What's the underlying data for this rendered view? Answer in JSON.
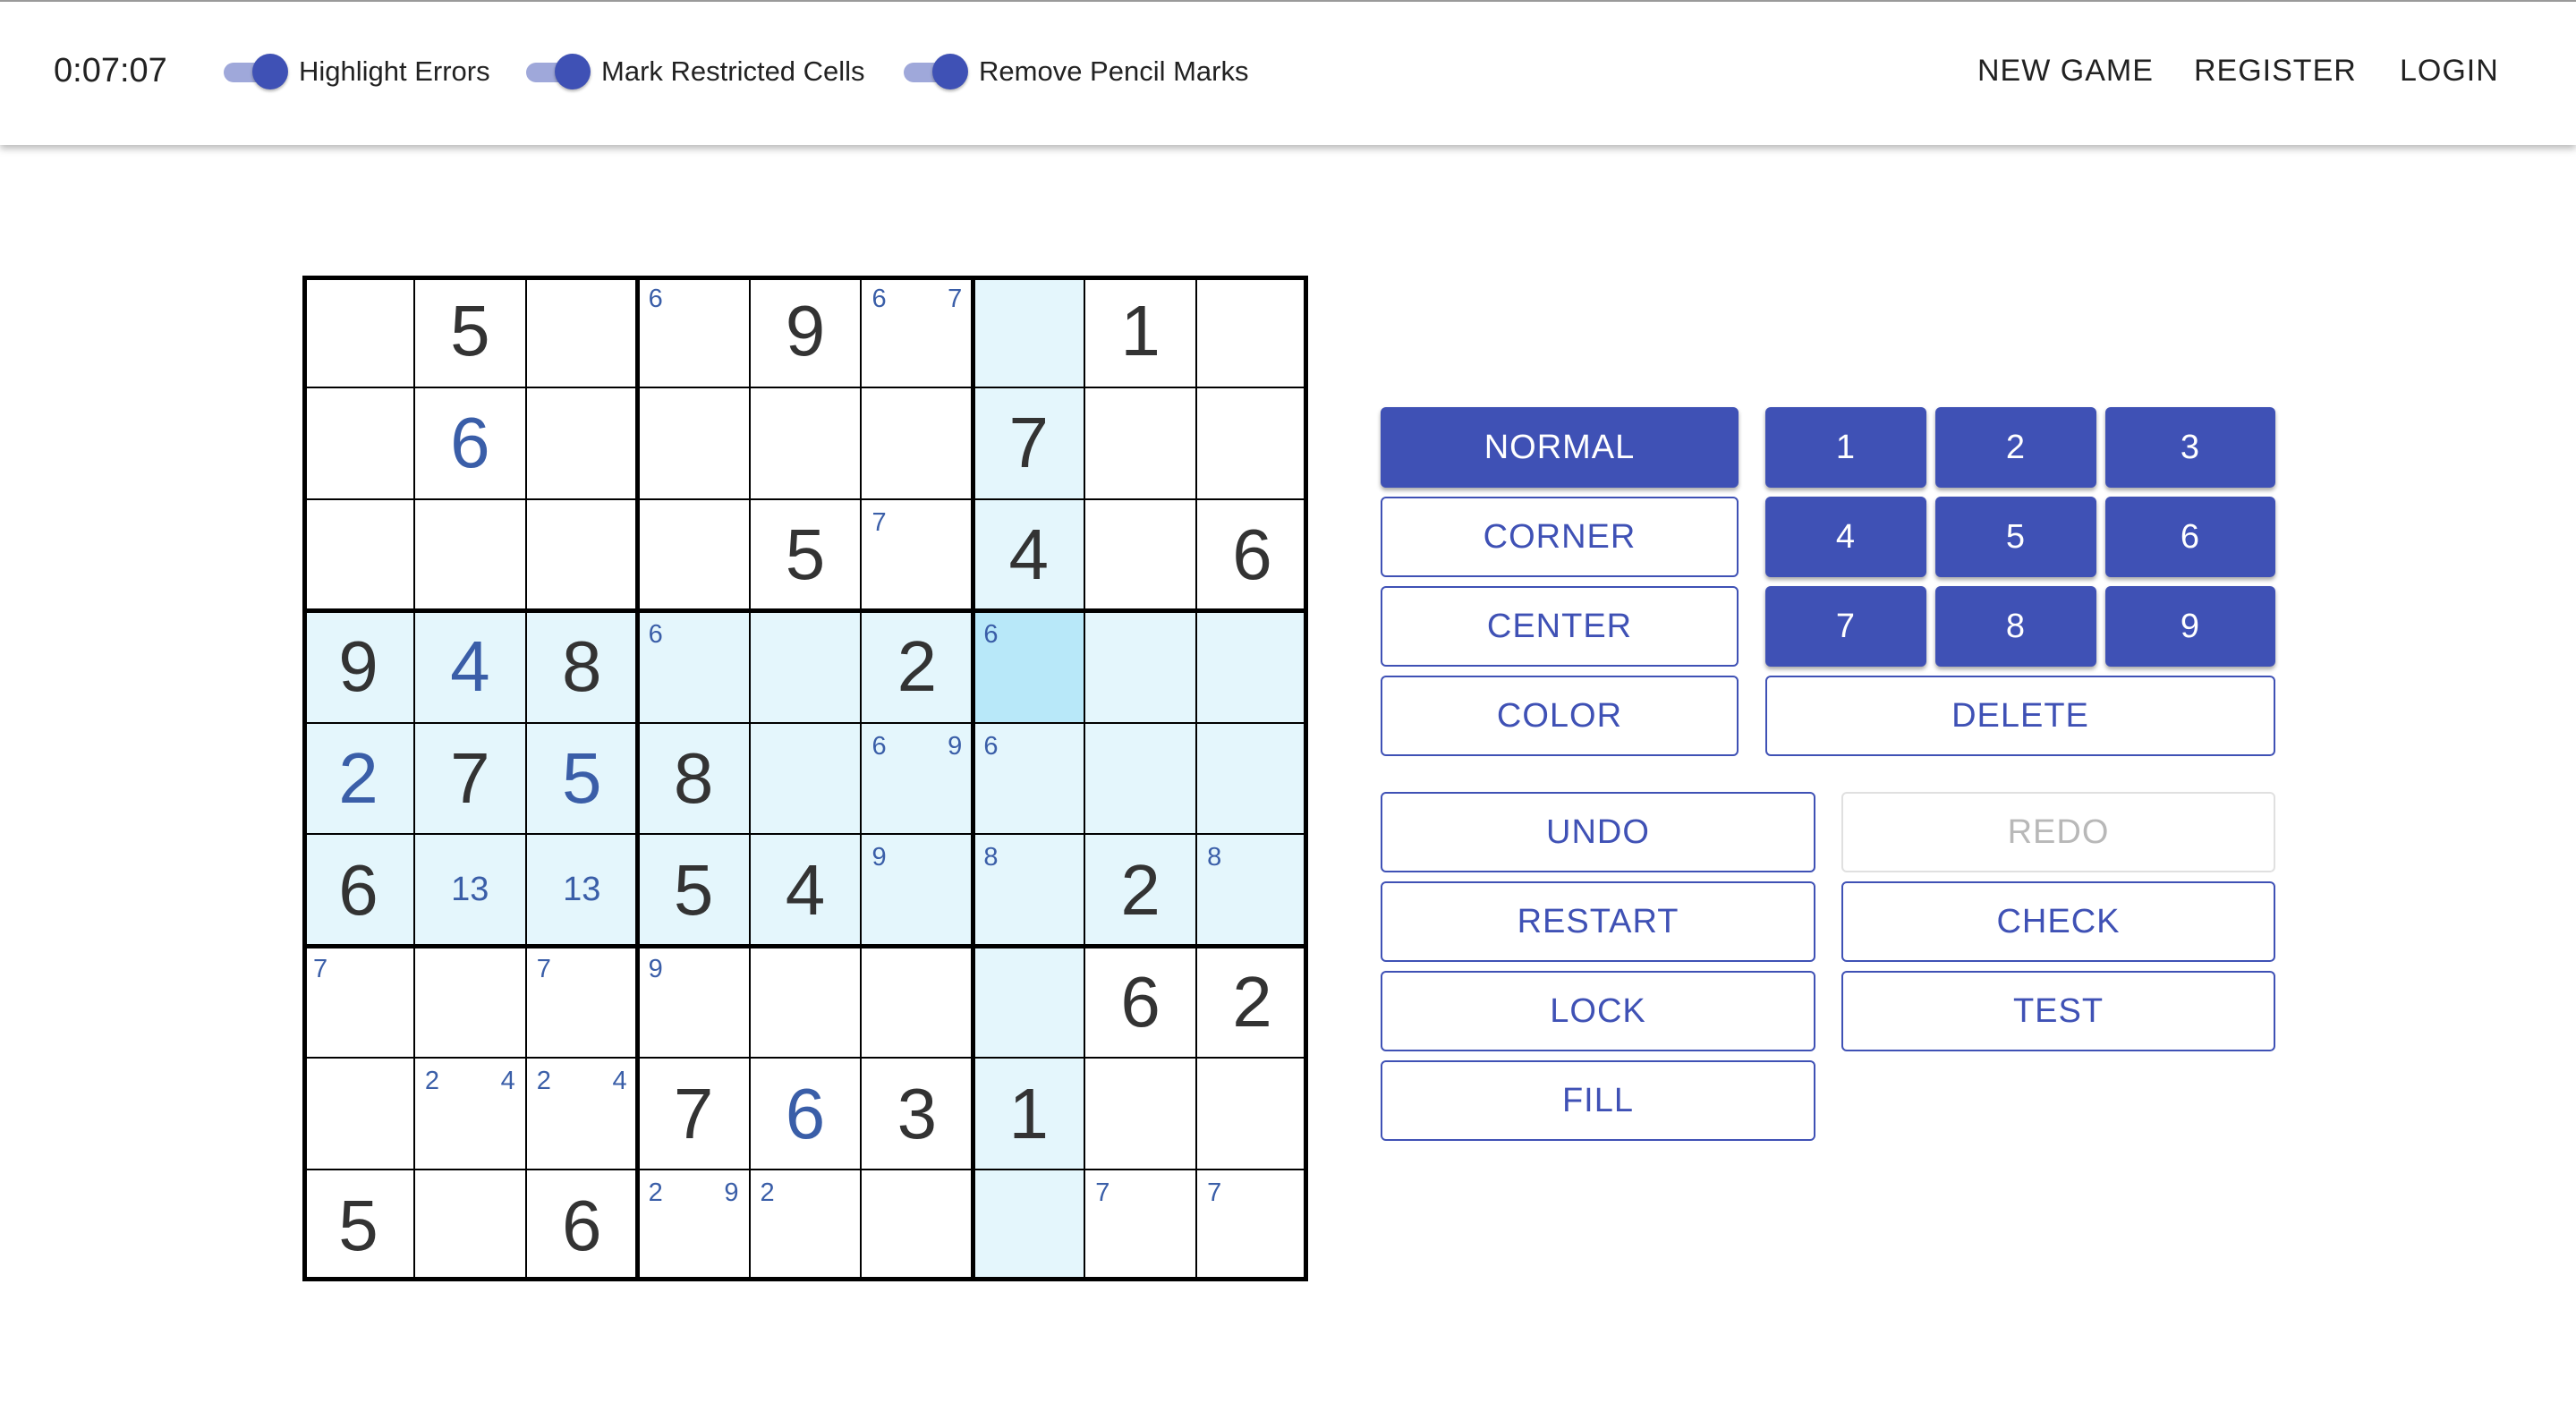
{
  "header": {
    "timer": "0:07:07",
    "toggles": [
      {
        "label": "Highlight Errors",
        "on": true
      },
      {
        "label": "Mark Restricted Cells",
        "on": true
      },
      {
        "label": "Remove Pencil Marks",
        "on": true
      }
    ],
    "nav": {
      "new_game": "NEW GAME",
      "register": "REGISTER",
      "login": "LOGIN"
    }
  },
  "colors": {
    "accent": "#3f51b5",
    "toggle_track": "#9fa8da",
    "given_digit": "#333333",
    "entered_digit": "#3a5ea8",
    "pencil_mark": "#3a5ea8",
    "highlight": "#e4f6fc",
    "selected": "#b8e8f9"
  },
  "board": {
    "selected": [
      3,
      6
    ],
    "highlighted_rows": [
      3,
      4,
      5
    ],
    "highlighted_cols": [
      6
    ],
    "cells": [
      [
        {
          "v": "",
          "t": "empty",
          "corner": [],
          "center": ""
        },
        {
          "v": "5",
          "t": "given",
          "corner": [],
          "center": ""
        },
        {
          "v": "",
          "t": "empty",
          "corner": [],
          "center": ""
        },
        {
          "v": "",
          "t": "empty",
          "corner": [
            "6"
          ],
          "center": ""
        },
        {
          "v": "9",
          "t": "given",
          "corner": [],
          "center": ""
        },
        {
          "v": "",
          "t": "empty",
          "corner": [
            "6",
            "7"
          ],
          "center": ""
        },
        {
          "v": "",
          "t": "empty",
          "corner": [],
          "center": ""
        },
        {
          "v": "1",
          "t": "given",
          "corner": [],
          "center": ""
        },
        {
          "v": "",
          "t": "empty",
          "corner": [],
          "center": ""
        }
      ],
      [
        {
          "v": "",
          "t": "empty",
          "corner": [],
          "center": ""
        },
        {
          "v": "6",
          "t": "entered",
          "corner": [],
          "center": ""
        },
        {
          "v": "",
          "t": "empty",
          "corner": [],
          "center": ""
        },
        {
          "v": "",
          "t": "empty",
          "corner": [],
          "center": ""
        },
        {
          "v": "",
          "t": "empty",
          "corner": [],
          "center": ""
        },
        {
          "v": "",
          "t": "empty",
          "corner": [],
          "center": ""
        },
        {
          "v": "7",
          "t": "given",
          "corner": [],
          "center": ""
        },
        {
          "v": "",
          "t": "empty",
          "corner": [],
          "center": ""
        },
        {
          "v": "",
          "t": "empty",
          "corner": [],
          "center": ""
        }
      ],
      [
        {
          "v": "",
          "t": "empty",
          "corner": [],
          "center": ""
        },
        {
          "v": "",
          "t": "empty",
          "corner": [],
          "center": ""
        },
        {
          "v": "",
          "t": "empty",
          "corner": [],
          "center": ""
        },
        {
          "v": "",
          "t": "empty",
          "corner": [],
          "center": ""
        },
        {
          "v": "5",
          "t": "given",
          "corner": [],
          "center": ""
        },
        {
          "v": "",
          "t": "empty",
          "corner": [
            "7"
          ],
          "center": ""
        },
        {
          "v": "4",
          "t": "given",
          "corner": [],
          "center": ""
        },
        {
          "v": "",
          "t": "empty",
          "corner": [],
          "center": ""
        },
        {
          "v": "6",
          "t": "given",
          "corner": [],
          "center": ""
        }
      ],
      [
        {
          "v": "9",
          "t": "given",
          "corner": [],
          "center": ""
        },
        {
          "v": "4",
          "t": "entered",
          "corner": [],
          "center": ""
        },
        {
          "v": "8",
          "t": "given",
          "corner": [],
          "center": ""
        },
        {
          "v": "",
          "t": "empty",
          "corner": [
            "6"
          ],
          "center": ""
        },
        {
          "v": "",
          "t": "empty",
          "corner": [],
          "center": ""
        },
        {
          "v": "2",
          "t": "given",
          "corner": [],
          "center": ""
        },
        {
          "v": "",
          "t": "empty",
          "corner": [
            "6"
          ],
          "center": ""
        },
        {
          "v": "",
          "t": "empty",
          "corner": [],
          "center": ""
        },
        {
          "v": "",
          "t": "empty",
          "corner": [],
          "center": ""
        }
      ],
      [
        {
          "v": "2",
          "t": "entered",
          "corner": [],
          "center": ""
        },
        {
          "v": "7",
          "t": "given",
          "corner": [],
          "center": ""
        },
        {
          "v": "5",
          "t": "entered",
          "corner": [],
          "center": ""
        },
        {
          "v": "8",
          "t": "given",
          "corner": [],
          "center": ""
        },
        {
          "v": "",
          "t": "empty",
          "corner": [],
          "center": ""
        },
        {
          "v": "",
          "t": "empty",
          "corner": [
            "6",
            "9"
          ],
          "center": ""
        },
        {
          "v": "",
          "t": "empty",
          "corner": [
            "6"
          ],
          "center": ""
        },
        {
          "v": "",
          "t": "empty",
          "corner": [],
          "center": ""
        },
        {
          "v": "",
          "t": "empty",
          "corner": [],
          "center": ""
        }
      ],
      [
        {
          "v": "6",
          "t": "given",
          "corner": [],
          "center": ""
        },
        {
          "v": "",
          "t": "empty",
          "corner": [],
          "center": "13"
        },
        {
          "v": "",
          "t": "empty",
          "corner": [],
          "center": "13"
        },
        {
          "v": "5",
          "t": "given",
          "corner": [],
          "center": ""
        },
        {
          "v": "4",
          "t": "given",
          "corner": [],
          "center": ""
        },
        {
          "v": "",
          "t": "empty",
          "corner": [
            "9"
          ],
          "center": ""
        },
        {
          "v": "",
          "t": "empty",
          "corner": [
            "8"
          ],
          "center": ""
        },
        {
          "v": "2",
          "t": "given",
          "corner": [],
          "center": ""
        },
        {
          "v": "",
          "t": "empty",
          "corner": [
            "8"
          ],
          "center": ""
        }
      ],
      [
        {
          "v": "",
          "t": "empty",
          "corner": [
            "7"
          ],
          "center": ""
        },
        {
          "v": "",
          "t": "empty",
          "corner": [],
          "center": ""
        },
        {
          "v": "",
          "t": "empty",
          "corner": [
            "7"
          ],
          "center": ""
        },
        {
          "v": "",
          "t": "empty",
          "corner": [
            "9"
          ],
          "center": ""
        },
        {
          "v": "",
          "t": "empty",
          "corner": [],
          "center": ""
        },
        {
          "v": "",
          "t": "empty",
          "corner": [],
          "center": ""
        },
        {
          "v": "",
          "t": "empty",
          "corner": [],
          "center": ""
        },
        {
          "v": "6",
          "t": "given",
          "corner": [],
          "center": ""
        },
        {
          "v": "2",
          "t": "given",
          "corner": [],
          "center": ""
        }
      ],
      [
        {
          "v": "",
          "t": "empty",
          "corner": [],
          "center": ""
        },
        {
          "v": "",
          "t": "empty",
          "corner": [
            "2",
            "4"
          ],
          "center": ""
        },
        {
          "v": "",
          "t": "empty",
          "corner": [
            "2",
            "4"
          ],
          "center": ""
        },
        {
          "v": "7",
          "t": "given",
          "corner": [],
          "center": ""
        },
        {
          "v": "6",
          "t": "entered",
          "corner": [],
          "center": ""
        },
        {
          "v": "3",
          "t": "given",
          "corner": [],
          "center": ""
        },
        {
          "v": "1",
          "t": "given",
          "corner": [],
          "center": ""
        },
        {
          "v": "",
          "t": "empty",
          "corner": [],
          "center": ""
        },
        {
          "v": "",
          "t": "empty",
          "corner": [],
          "center": ""
        }
      ],
      [
        {
          "v": "5",
          "t": "given",
          "corner": [],
          "center": ""
        },
        {
          "v": "",
          "t": "empty",
          "corner": [],
          "center": ""
        },
        {
          "v": "6",
          "t": "given",
          "corner": [],
          "center": ""
        },
        {
          "v": "",
          "t": "empty",
          "corner": [
            "2",
            "9"
          ],
          "center": ""
        },
        {
          "v": "",
          "t": "empty",
          "corner": [
            "2"
          ],
          "center": ""
        },
        {
          "v": "",
          "t": "empty",
          "corner": [],
          "center": ""
        },
        {
          "v": "",
          "t": "empty",
          "corner": [],
          "center": ""
        },
        {
          "v": "",
          "t": "empty",
          "corner": [
            "7"
          ],
          "center": ""
        },
        {
          "v": "",
          "t": "empty",
          "corner": [
            "7"
          ],
          "center": ""
        }
      ]
    ]
  },
  "controls": {
    "modes": [
      {
        "label": "NORMAL",
        "active": true
      },
      {
        "label": "CORNER",
        "active": false
      },
      {
        "label": "CENTER",
        "active": false
      },
      {
        "label": "COLOR",
        "active": false
      }
    ],
    "numpad": [
      "1",
      "2",
      "3",
      "4",
      "5",
      "6",
      "7",
      "8",
      "9"
    ],
    "delete": "DELETE",
    "actions": [
      {
        "label": "UNDO",
        "disabled": false
      },
      {
        "label": "REDO",
        "disabled": true
      },
      {
        "label": "RESTART",
        "disabled": false
      },
      {
        "label": "CHECK",
        "disabled": false
      },
      {
        "label": "LOCK",
        "disabled": false
      },
      {
        "label": "TEST",
        "disabled": false
      },
      {
        "label": "FILL",
        "disabled": false
      }
    ]
  }
}
